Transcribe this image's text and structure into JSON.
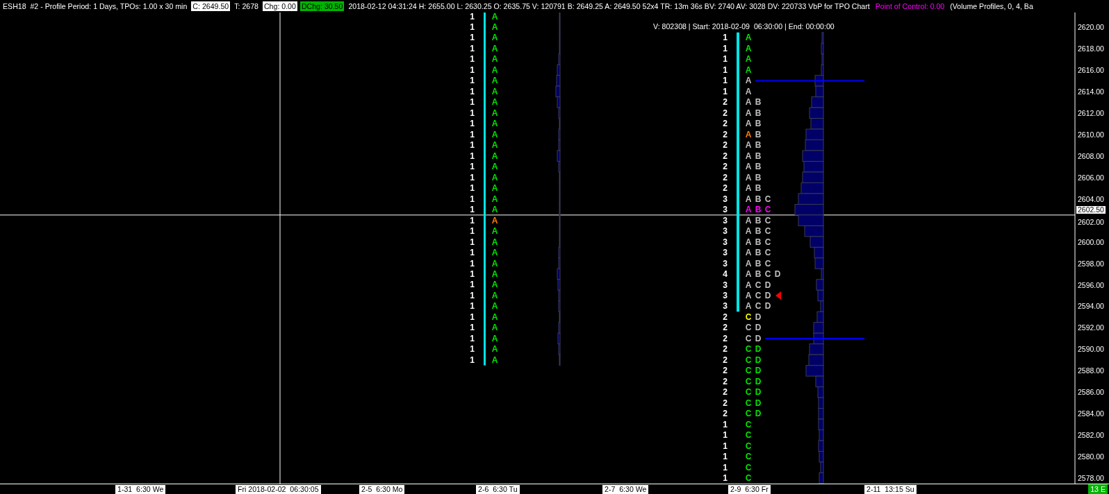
{
  "header": [
    {
      "text": "ESH18  #2 - Profile Period: 1 Days, TPOs: 1.00 x 30 min",
      "kind": "plain"
    },
    {
      "text": "C: 2649.50",
      "kind": "boxed"
    },
    {
      "text": "T: 2678",
      "kind": "plain"
    },
    {
      "text": "Chg: 0.00",
      "kind": "boxed"
    },
    {
      "text": "DChg: 30.50",
      "kind": "highlight"
    },
    {
      "text": "2018-02-12 04:31:24 H: 2655.00 L: 2630.25 O: 2635.75 V: 120791 B: 2649.25 A: 2649.50 52x4 TR: 13m 36s BV: 2740 AV: 3028 DV: 220733 VbP for TPO Chart",
      "kind": "plain"
    },
    {
      "text": "Point of Control: 0.00",
      "kind": "accent"
    },
    {
      "text": "(Volume Profiles, 0, 4, Ba",
      "kind": "plain"
    }
  ],
  "profile_info": "V: 802308 | Start: 2018-02-09  06:30:00 | End: 00:00:00",
  "profiles": [
    {
      "rows": [
        {
          "count": "1",
          "letters": [
            {
              "text": "A",
              "color": "#00e600"
            }
          ]
        },
        {
          "count": "1",
          "letters": [
            {
              "text": "A",
              "color": "#00e600"
            }
          ]
        },
        {
          "count": "1",
          "letters": [
            {
              "text": "A",
              "color": "#00e600"
            }
          ]
        },
        {
          "count": "1",
          "letters": [
            {
              "text": "A",
              "color": "#00e600"
            }
          ]
        },
        {
          "count": "1",
          "letters": [
            {
              "text": "A",
              "color": "#00e600"
            }
          ]
        },
        {
          "count": "1",
          "letters": [
            {
              "text": "A",
              "color": "#00e600"
            }
          ]
        },
        {
          "count": "1",
          "letters": [
            {
              "text": "A",
              "color": "#00e600"
            }
          ]
        },
        {
          "count": "1",
          "letters": [
            {
              "text": "A",
              "color": "#00e600"
            }
          ]
        },
        {
          "count": "1",
          "letters": [
            {
              "text": "A",
              "color": "#00e600"
            }
          ]
        },
        {
          "count": "1",
          "letters": [
            {
              "text": "A",
              "color": "#00e600"
            }
          ]
        },
        {
          "count": "1",
          "letters": [
            {
              "text": "A",
              "color": "#00e600"
            }
          ]
        },
        {
          "count": "1",
          "letters": [
            {
              "text": "A",
              "color": "#00e600"
            }
          ]
        },
        {
          "count": "1",
          "letters": [
            {
              "text": "A",
              "color": "#00e600"
            }
          ]
        },
        {
          "count": "1",
          "letters": [
            {
              "text": "A",
              "color": "#00e600"
            }
          ]
        },
        {
          "count": "1",
          "letters": [
            {
              "text": "A",
              "color": "#00e600"
            }
          ]
        },
        {
          "count": "1",
          "letters": [
            {
              "text": "A",
              "color": "#00e600"
            }
          ]
        },
        {
          "count": "1",
          "letters": [
            {
              "text": "A",
              "color": "#00e600"
            }
          ]
        },
        {
          "count": "1",
          "letters": [
            {
              "text": "A",
              "color": "#00e600"
            }
          ]
        },
        {
          "count": "1",
          "letters": [
            {
              "text": "A",
              "color": "#00e600"
            }
          ]
        },
        {
          "count": "1",
          "letters": [
            {
              "text": "A",
              "color": "#ff8000"
            }
          ]
        },
        {
          "count": "1",
          "letters": [
            {
              "text": "A",
              "color": "#00e600"
            }
          ]
        },
        {
          "count": "1",
          "letters": [
            {
              "text": "A",
              "color": "#00e600"
            }
          ]
        },
        {
          "count": "1",
          "letters": [
            {
              "text": "A",
              "color": "#00e600"
            }
          ]
        },
        {
          "count": "1",
          "letters": [
            {
              "text": "A",
              "color": "#00e600"
            }
          ]
        },
        {
          "count": "1",
          "letters": [
            {
              "text": "A",
              "color": "#00e600"
            }
          ]
        },
        {
          "count": "1",
          "letters": [
            {
              "text": "A",
              "color": "#00e600"
            }
          ]
        },
        {
          "count": "1",
          "letters": [
            {
              "text": "A",
              "color": "#00e600"
            }
          ]
        },
        {
          "count": "1",
          "letters": [
            {
              "text": "A",
              "color": "#00e600"
            }
          ]
        },
        {
          "count": "1",
          "letters": [
            {
              "text": "A",
              "color": "#00e600"
            }
          ]
        },
        {
          "count": "1",
          "letters": [
            {
              "text": "A",
              "color": "#00e600"
            }
          ]
        },
        {
          "count": "1",
          "letters": [
            {
              "text": "A",
              "color": "#00e600"
            }
          ]
        },
        {
          "count": "1",
          "letters": [
            {
              "text": "A",
              "color": "#00e600"
            }
          ]
        },
        {
          "count": "1",
          "letters": [
            {
              "text": "A",
              "color": "#00e600"
            }
          ]
        }
      ]
    },
    {
      "rows": [
        {
          "count": "1",
          "letters": [
            {
              "text": "A",
              "color": "#00e600"
            }
          ]
        },
        {
          "count": "1",
          "letters": [
            {
              "text": "A",
              "color": "#00e600"
            }
          ]
        },
        {
          "count": "1",
          "letters": [
            {
              "text": "A",
              "color": "#00e600"
            }
          ]
        },
        {
          "count": "1",
          "letters": [
            {
              "text": "A",
              "color": "#00e600"
            }
          ]
        },
        {
          "count": "1",
          "letters": [
            {
              "text": "A",
              "color": "#c0c0c0"
            }
          ]
        },
        {
          "count": "1",
          "letters": [
            {
              "text": "A",
              "color": "#c0c0c0"
            }
          ]
        },
        {
          "count": "2",
          "letters": [
            {
              "text": "A",
              "color": "#c0c0c0"
            },
            {
              "text": "B",
              "color": "#c0c0c0"
            }
          ]
        },
        {
          "count": "2",
          "letters": [
            {
              "text": "A",
              "color": "#c0c0c0"
            },
            {
              "text": "B",
              "color": "#c0c0c0"
            }
          ]
        },
        {
          "count": "2",
          "letters": [
            {
              "text": "A",
              "color": "#c0c0c0"
            },
            {
              "text": "B",
              "color": "#c0c0c0"
            }
          ]
        },
        {
          "count": "2",
          "letters": [
            {
              "text": "A",
              "color": "#ff8000"
            },
            {
              "text": "B",
              "color": "#c0c0c0"
            }
          ]
        },
        {
          "count": "2",
          "letters": [
            {
              "text": "A",
              "color": "#c0c0c0"
            },
            {
              "text": "B",
              "color": "#c0c0c0"
            }
          ]
        },
        {
          "count": "2",
          "letters": [
            {
              "text": "A",
              "color": "#c0c0c0"
            },
            {
              "text": "B",
              "color": "#c0c0c0"
            }
          ]
        },
        {
          "count": "2",
          "letters": [
            {
              "text": "A",
              "color": "#c0c0c0"
            },
            {
              "text": "B",
              "color": "#c0c0c0"
            }
          ]
        },
        {
          "count": "2",
          "letters": [
            {
              "text": "A",
              "color": "#c0c0c0"
            },
            {
              "text": "B",
              "color": "#c0c0c0"
            }
          ]
        },
        {
          "count": "2",
          "letters": [
            {
              "text": "A",
              "color": "#c0c0c0"
            },
            {
              "text": "B",
              "color": "#c0c0c0"
            }
          ]
        },
        {
          "count": "3",
          "letters": [
            {
              "text": "A",
              "color": "#c0c0c0"
            },
            {
              "text": "B",
              "color": "#c0c0c0"
            },
            {
              "text": "C",
              "color": "#c0c0c0"
            }
          ]
        },
        {
          "count": "3",
          "letters": [
            {
              "text": "A",
              "color": "#ff00ff"
            },
            {
              "text": "B",
              "color": "#ff00ff"
            },
            {
              "text": "C",
              "color": "#ff00ff"
            }
          ]
        },
        {
          "count": "3",
          "letters": [
            {
              "text": "A",
              "color": "#c0c0c0"
            },
            {
              "text": "B",
              "color": "#c0c0c0"
            },
            {
              "text": "C",
              "color": "#c0c0c0"
            }
          ]
        },
        {
          "count": "3",
          "letters": [
            {
              "text": "A",
              "color": "#c0c0c0"
            },
            {
              "text": "B",
              "color": "#c0c0c0"
            },
            {
              "text": "C",
              "color": "#c0c0c0"
            }
          ]
        },
        {
          "count": "3",
          "letters": [
            {
              "text": "A",
              "color": "#c0c0c0"
            },
            {
              "text": "B",
              "color": "#c0c0c0"
            },
            {
              "text": "C",
              "color": "#c0c0c0"
            }
          ]
        },
        {
          "count": "3",
          "letters": [
            {
              "text": "A",
              "color": "#c0c0c0"
            },
            {
              "text": "B",
              "color": "#c0c0c0"
            },
            {
              "text": "C",
              "color": "#c0c0c0"
            }
          ]
        },
        {
          "count": "3",
          "letters": [
            {
              "text": "A",
              "color": "#c0c0c0"
            },
            {
              "text": "B",
              "color": "#c0c0c0"
            },
            {
              "text": "C",
              "color": "#c0c0c0"
            }
          ]
        },
        {
          "count": "4",
          "letters": [
            {
              "text": "A",
              "color": "#c0c0c0"
            },
            {
              "text": "B",
              "color": "#c0c0c0"
            },
            {
              "text": "C",
              "color": "#c0c0c0"
            },
            {
              "text": "D",
              "color": "#c0c0c0"
            }
          ]
        },
        {
          "count": "3",
          "letters": [
            {
              "text": "A",
              "color": "#c0c0c0"
            },
            {
              "text": "C",
              "color": "#c0c0c0"
            },
            {
              "text": "D",
              "color": "#c0c0c0"
            }
          ]
        },
        {
          "count": "3",
          "letters": [
            {
              "text": "A",
              "color": "#c0c0c0"
            },
            {
              "text": "C",
              "color": "#c0c0c0"
            },
            {
              "text": "D",
              "color": "#c0c0c0"
            }
          ]
        },
        {
          "count": "3",
          "letters": [
            {
              "text": "A",
              "color": "#c0c0c0"
            },
            {
              "text": "C",
              "color": "#c0c0c0"
            },
            {
              "text": "D",
              "color": "#c0c0c0"
            }
          ]
        },
        {
          "count": "2",
          "letters": [
            {
              "text": "C",
              "color": "#ffff00"
            },
            {
              "text": "D",
              "color": "#c0c0c0"
            }
          ]
        },
        {
          "count": "2",
          "letters": [
            {
              "text": "C",
              "color": "#c0c0c0"
            },
            {
              "text": "D",
              "color": "#c0c0c0"
            }
          ]
        },
        {
          "count": "2",
          "letters": [
            {
              "text": "C",
              "color": "#c0c0c0"
            },
            {
              "text": "D",
              "color": "#c0c0c0"
            }
          ]
        },
        {
          "count": "2",
          "letters": [
            {
              "text": "C",
              "color": "#00e600"
            },
            {
              "text": "D",
              "color": "#00e600"
            }
          ]
        },
        {
          "count": "2",
          "letters": [
            {
              "text": "C",
              "color": "#00e600"
            },
            {
              "text": "D",
              "color": "#00e600"
            }
          ]
        },
        {
          "count": "2",
          "letters": [
            {
              "text": "C",
              "color": "#00e600"
            },
            {
              "text": "D",
              "color": "#00e600"
            }
          ]
        },
        {
          "count": "2",
          "letters": [
            {
              "text": "C",
              "color": "#00e600"
            },
            {
              "text": "D",
              "color": "#00e600"
            }
          ]
        },
        {
          "count": "2",
          "letters": [
            {
              "text": "C",
              "color": "#00e600"
            },
            {
              "text": "D",
              "color": "#00e600"
            }
          ]
        },
        {
          "count": "2",
          "letters": [
            {
              "text": "C",
              "color": "#00e600"
            },
            {
              "text": "D",
              "color": "#00e600"
            }
          ]
        },
        {
          "count": "2",
          "letters": [
            {
              "text": "C",
              "color": "#00e600"
            },
            {
              "text": "D",
              "color": "#00e600"
            }
          ]
        },
        {
          "count": "1",
          "letters": [
            {
              "text": "C",
              "color": "#00e600"
            }
          ]
        },
        {
          "count": "1",
          "letters": [
            {
              "text": "C",
              "color": "#00e600"
            }
          ]
        },
        {
          "count": "1",
          "letters": [
            {
              "text": "C",
              "color": "#00e600"
            }
          ]
        },
        {
          "count": "1",
          "letters": [
            {
              "text": "C",
              "color": "#00e600"
            }
          ]
        },
        {
          "count": "1",
          "letters": [
            {
              "text": "C",
              "color": "#00e600"
            }
          ]
        },
        {
          "count": "1",
          "letters": [
            {
              "text": "C",
              "color": "#00e600"
            }
          ]
        }
      ]
    }
  ],
  "price_axis": {
    "labels": [
      "2620.00",
      "2618.00",
      "2616.00",
      "2614.00",
      "2612.00",
      "2610.00",
      "2608.00",
      "2606.00",
      "2604.00",
      "2602.00",
      "2600.00",
      "2598.00",
      "2596.00",
      "2594.00",
      "2592.00",
      "2590.00",
      "2588.00",
      "2586.00",
      "2584.00",
      "2582.00",
      "2580.00",
      "2578.00"
    ],
    "current": "2602.50"
  },
  "time_axis": {
    "labels": [
      "1-31  6:30 We",
      "Fri 2018-02-02  06:30:05",
      "2-5  6:30 Mo",
      "2-6  6:30 Tu",
      "2-7  6:30 We",
      "2-9  6:30 Fr",
      "2-11  13:15 Su"
    ],
    "badge": "13 E"
  }
}
